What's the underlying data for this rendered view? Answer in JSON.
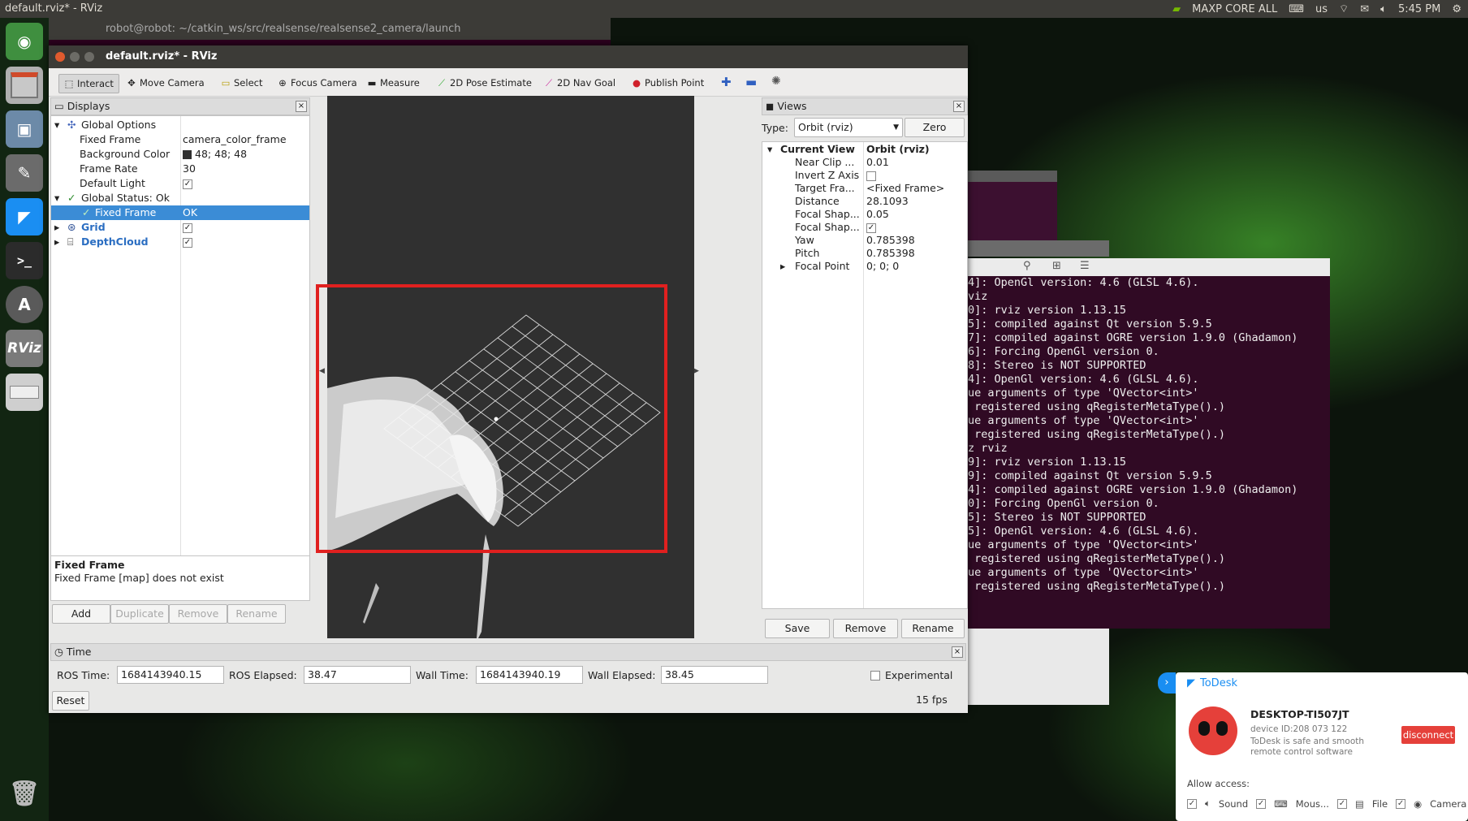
{
  "desktop": {
    "active_app_title": "default.rviz* - RViz",
    "tray": {
      "perf_mode": "MAXP CORE ALL",
      "keyboard": "us",
      "clock": "5:45 PM"
    }
  },
  "launcher": {
    "items": [
      "ubuntu-home-icon",
      "files-icon",
      "trash-box-icon",
      "settings-icon",
      "todesk-icon",
      "terminal-icon",
      "software-updater-icon",
      "rviz-icon",
      "drive-icon",
      "trash-icon"
    ],
    "rviz_label": "RViz"
  },
  "bg_terminal": {
    "title": "robot@robot: ~/catkin_ws/src/realsense/realsense2_camera/launch"
  },
  "terminal_lines": [
    "4]: OpenGl version: 4.6 (GLSL 4.6).",
    "viz",
    "0]: rviz version 1.13.15",
    "5]: compiled against Qt version 5.9.5",
    "7]: compiled against OGRE version 1.9.0 (Ghadamon)",
    "6]: Forcing OpenGl version 0.",
    "8]: Stereo is NOT SUPPORTED",
    "4]: OpenGl version: 4.6 (GLSL 4.6).",
    "ue arguments of type 'QVector<int>'",
    " registered using qRegisterMetaType().)",
    "ue arguments of type 'QVector<int>'",
    " registered using qRegisterMetaType().)",
    "z rviz",
    "9]: rviz version 1.13.15",
    "9]: compiled against Qt version 5.9.5",
    "4]: compiled against OGRE version 1.9.0 (Ghadamon)",
    "0]: Forcing OpenGl version 0.",
    "5]: Stereo is NOT SUPPORTED",
    "5]: OpenGl version: 4.6 (GLSL 4.6).",
    "ue arguments of type 'QVector<int>'",
    " registered using qRegisterMetaType().)",
    "ue arguments of type 'QVector<int>'",
    " registered using qRegisterMetaType().)"
  ],
  "rviz": {
    "title": "default.rviz* - RViz",
    "toolbar": {
      "interact": "Interact",
      "move_camera": "Move Camera",
      "select": "Select",
      "focus_camera": "Focus Camera",
      "measure": "Measure",
      "pose_estimate": "2D Pose Estimate",
      "nav_goal": "2D Nav Goal",
      "publish_point": "Publish Point"
    },
    "displays": {
      "title": "Displays",
      "global_options": "Global Options",
      "fixed_frame_label": "Fixed Frame",
      "fixed_frame_value": "camera_color_frame",
      "bg_color_label": "Background Color",
      "bg_color_value": "48; 48; 48",
      "bg_color_swatch": "#303030",
      "frame_rate_label": "Frame Rate",
      "frame_rate_value": "30",
      "default_light_label": "Default Light",
      "global_status": "Global Status: Ok",
      "status_fixed_frame": "Fixed Frame",
      "status_fixed_frame_value": "OK",
      "grid": "Grid",
      "depthcloud": "DepthCloud",
      "desc_title": "Fixed Frame",
      "desc_text": "Fixed Frame [map] does not exist",
      "add": "Add",
      "duplicate": "Duplicate",
      "remove": "Remove",
      "rename": "Rename"
    },
    "views": {
      "title": "Views",
      "type_label": "Type:",
      "type_value": "Orbit (rviz)",
      "zero": "Zero",
      "current_view": "Current View",
      "current_view_type": "Orbit (rviz)",
      "near_clip": "Near Clip ...",
      "near_clip_value": "0.01",
      "invert_z": "Invert Z Axis",
      "target_frame": "Target Fra...",
      "target_frame_value": "<Fixed Frame>",
      "distance": "Distance",
      "distance_value": "28.1093",
      "focal_shape1": "Focal Shap...",
      "focal_shape1_value": "0.05",
      "focal_shape2": "Focal Shap...",
      "yaw": "Yaw",
      "yaw_value": "0.785398",
      "pitch": "Pitch",
      "pitch_value": "0.785398",
      "focal_point": "Focal Point",
      "focal_point_value": "0; 0; 0",
      "save": "Save",
      "remove": "Remove",
      "rename": "Rename"
    },
    "time": {
      "title": "Time",
      "ros_time_label": "ROS Time:",
      "ros_time": "1684143940.15",
      "ros_elapsed_label": "ROS Elapsed:",
      "ros_elapsed": "38.47",
      "wall_time_label": "Wall Time:",
      "wall_time": "1684143940.19",
      "wall_elapsed_label": "Wall Elapsed:",
      "wall_elapsed": "38.45",
      "experimental": "Experimental",
      "reset": "Reset",
      "fps": "15 fps"
    }
  },
  "todesk": {
    "brand": "ToDesk",
    "device_name": "DESKTOP-TI507JT",
    "device_id": "device ID:208 073 122",
    "tagline": "ToDesk is safe and smooth remote control software",
    "disconnect": "disconnect",
    "allow_access": "Allow access:",
    "sound": "Sound",
    "mouse": "Mous...",
    "file": "File",
    "camera": "Camera"
  },
  "colors": {
    "highlight": "#e0201f",
    "selection": "#3b8cd6",
    "terminal_bg": "#300a24"
  }
}
